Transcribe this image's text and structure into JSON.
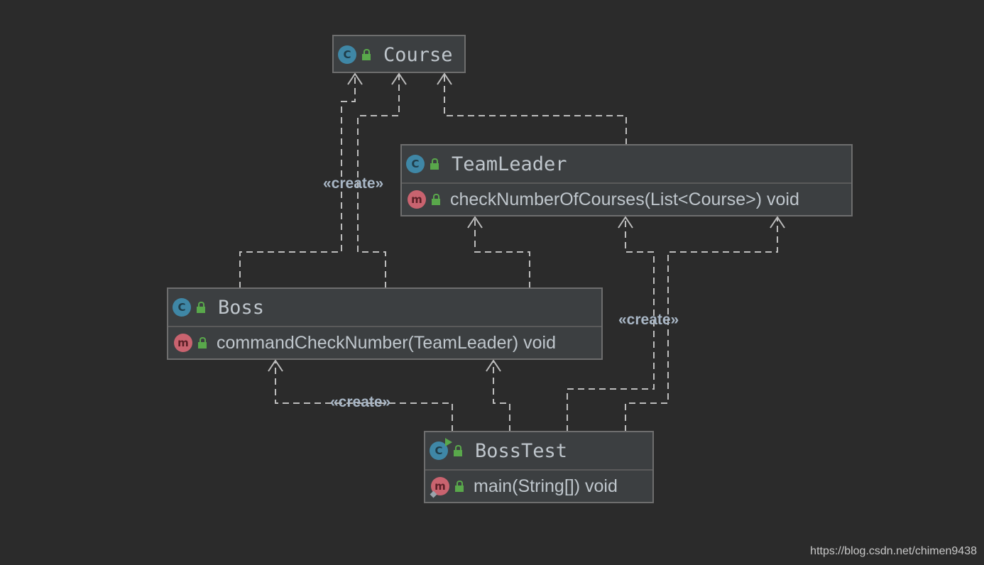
{
  "diagram": {
    "classes": [
      {
        "id": "course",
        "name": "Course",
        "kind": "class",
        "members": []
      },
      {
        "id": "teamleader",
        "name": "TeamLeader",
        "kind": "class",
        "members": [
          {
            "signature": "checkNumberOfCourses(List<Course>) void"
          }
        ]
      },
      {
        "id": "boss",
        "name": "Boss",
        "kind": "class",
        "members": [
          {
            "signature": "commandCheckNumber(TeamLeader) void"
          }
        ]
      },
      {
        "id": "bosstest",
        "name": "BossTest",
        "kind": "runnable-class",
        "members": [
          {
            "signature": "main(String[]) void"
          }
        ]
      }
    ],
    "edge_labels": {
      "boss_creates_course": "«create»",
      "bosstest_creates_teamleader": "«create»",
      "bosstest_creates_boss": "«create»"
    },
    "badges": {
      "class_letter": "C",
      "method_letter": "m"
    },
    "colors": {
      "background": "#2b2b2b",
      "node_fill": "#3c3f41",
      "class_badge": "#3f87a6",
      "method_badge": "#c9636f",
      "public_lock": "#59a84b",
      "edge": "#bdbdbd"
    }
  },
  "watermark": "https://blog.csdn.net/chimen9438"
}
